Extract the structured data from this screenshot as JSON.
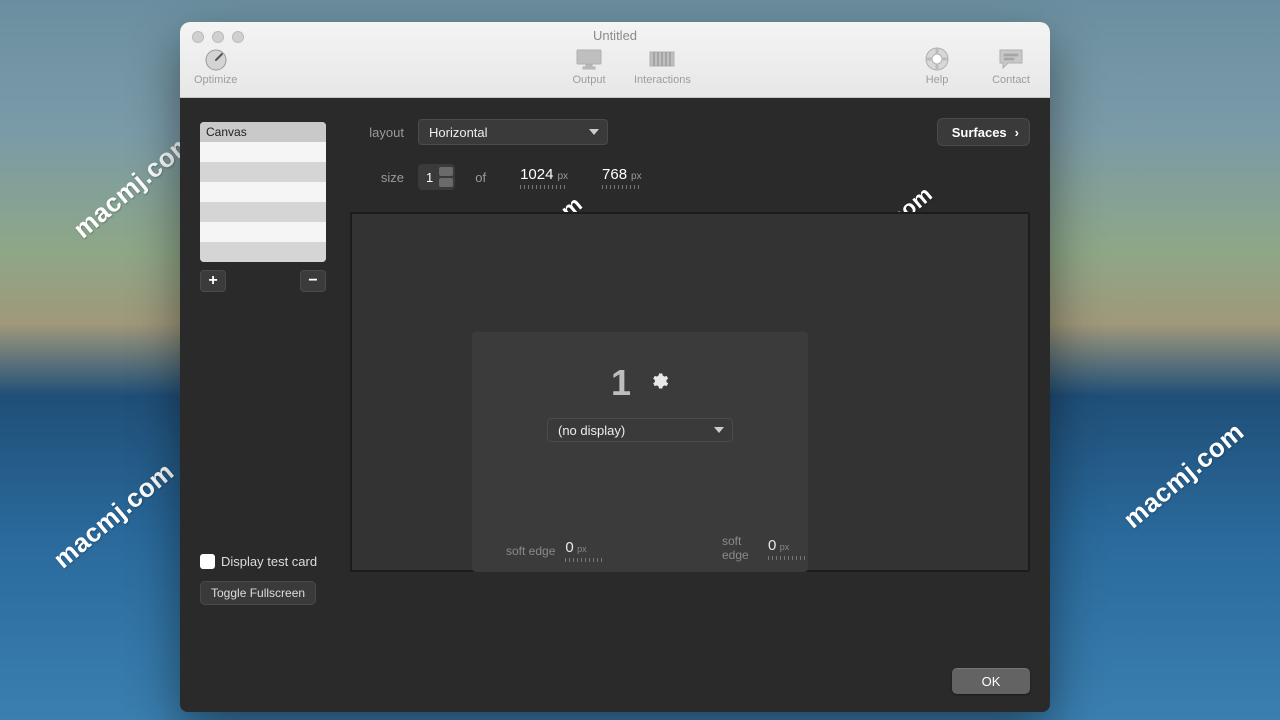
{
  "watermark_text": "macmj.com",
  "window": {
    "title": "Untitled"
  },
  "toolbar": {
    "optimize": "Optimize",
    "output": "Output",
    "interactions": "Interactions",
    "help": "Help",
    "contact": "Contact"
  },
  "sidebar": {
    "items": [
      "Canvas"
    ],
    "add_icon": "+",
    "remove_icon": "−",
    "display_test_card": "Display test card",
    "toggle_fullscreen": "Toggle Fullscreen"
  },
  "main": {
    "layout_label": "layout",
    "layout_value": "Horizontal",
    "surfaces_label": "Surfaces",
    "size_label": "size",
    "size_count": "1",
    "of_label": "of",
    "width": "1024",
    "height": "768",
    "px": "px",
    "display": {
      "number": "1",
      "select": "(no display)"
    },
    "soft_edge_label": "soft edge",
    "soft_edge_left": "0",
    "soft_edge_right": "0",
    "ok": "OK"
  }
}
